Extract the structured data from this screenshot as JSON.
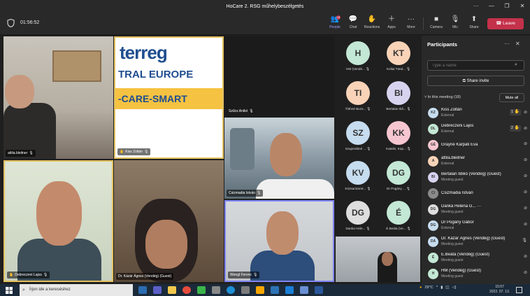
{
  "window": {
    "title": "HoCare 2. RSG műhelybeszélgetés"
  },
  "meeting": {
    "timer": "01:56:52"
  },
  "toolbar": {
    "people": {
      "label": "People",
      "badge": "18"
    },
    "chat": {
      "label": "Chat"
    },
    "reactions": {
      "label": "Reactions"
    },
    "apps": {
      "label": "Apps"
    },
    "more": {
      "label": "More"
    },
    "camera": {
      "label": "Camera"
    },
    "mic": {
      "label": "Mic"
    },
    "share": {
      "label": "Share"
    },
    "leave": {
      "label": "Leave"
    }
  },
  "tiles": {
    "t1": {
      "name": "attila.bleitner"
    },
    "t2": {
      "name": "Kiss Zoltán",
      "banner_line1": "terreg",
      "banner_line2": "TRAL EUROPE",
      "banner_line3": "-CARE-SMART"
    },
    "t3": {
      "name": "Szűcs Anikó"
    },
    "t4": {
      "name": "Csizmadia István"
    },
    "t5": {
      "name": "Debreczeni Lajos"
    },
    "t6": {
      "name": "Dr. Kázár Ágnes (Vendég) (Guest)"
    },
    "t7": {
      "name": "Wengl Ferenc"
    }
  },
  "avatar_grid": [
    {
      "initials": "H",
      "name": "HM (Vendé...",
      "color": "#c3e8d5"
    },
    {
      "initials": "KT",
      "name": "Koltai Tünd...",
      "color": "#f9d3b8"
    },
    {
      "initials": "TI",
      "name": "Tóthné Bucs...",
      "color": "#f9d3b8"
    },
    {
      "initials": "BI",
      "name": "Bertalan Ildi...",
      "color": "#d7d3ef"
    },
    {
      "initials": "SZ",
      "name": "Szuperákné ...",
      "color": "#c6dcef"
    },
    {
      "initials": "KK",
      "name": "Katalin, Kop...",
      "color": "#f6c6d0"
    },
    {
      "initials": "KV",
      "name": "Krizsanicsné...",
      "color": "#c6dcef"
    },
    {
      "initials": "DG",
      "name": "Dr Pogány ...",
      "color": "#c3e8d5"
    },
    {
      "initials": "DG",
      "name": "Danka Hele...",
      "color": "#dedede"
    },
    {
      "initials": "É",
      "name": "É.Beáta (Ve...",
      "color": "#c3e8d5"
    }
  ],
  "panel": {
    "title": "Participants",
    "search_placeholder": "Type a name",
    "share_invite": "Share invite",
    "section": "In this meeting (18)",
    "mute_all": "Mute all",
    "participants": [
      {
        "initials": "KZ",
        "name": "Kiss Zoltán",
        "sub": "External",
        "hand": "1",
        "color": "#c6dcef"
      },
      {
        "initials": "DL",
        "name": "Debreczeni Lajos",
        "sub": "External",
        "hand": "2",
        "color": "#c3e8d5"
      },
      {
        "initials": "GÉ",
        "name": "Grayné Kárpáti Éva",
        "sub": "",
        "hand": "",
        "color": "#f6c6d0"
      },
      {
        "initials": "A",
        "name": "attila.bleitner",
        "sub": "External",
        "hand": "",
        "color": "#f9d3b8"
      },
      {
        "initials": "BI",
        "name": "Bertalan Ildikó (Vendég) (Guest)",
        "sub": "Meeting guest",
        "hand": "",
        "color": "#d7d3ef"
      },
      {
        "initials": "CI",
        "name": "Csizmadia István",
        "sub": "",
        "hand": "",
        "color": "#8a8a8a"
      },
      {
        "initials": "DG",
        "name": "Danka Helena G... ···",
        "sub": "Meeting guest",
        "hand": "",
        "color": "#dedede"
      },
      {
        "initials": "DG",
        "name": "Dr Pogány Gábor",
        "sub": "External",
        "hand": "",
        "color": "#c6dcef"
      },
      {
        "initials": "DÁ",
        "name": "Dr. Kázár Ágnes (Vendég) (Guest)",
        "sub": "Meeting guest",
        "hand": "",
        "color": "#c6dcef"
      },
      {
        "initials": "É",
        "name": "É.Beáta (Vendég) (Guest)",
        "sub": "Meeting guest",
        "hand": "",
        "color": "#c3e8d5"
      },
      {
        "initials": "H",
        "name": "HM (Vendég) (Guest)",
        "sub": "Meeting guest",
        "hand": "",
        "color": "#c3e8d5"
      }
    ]
  },
  "taskbar": {
    "search_placeholder": "Írjon ide a kereséshez",
    "weather": "29°C",
    "time": "15:07",
    "date": "2022. 07. 13."
  }
}
